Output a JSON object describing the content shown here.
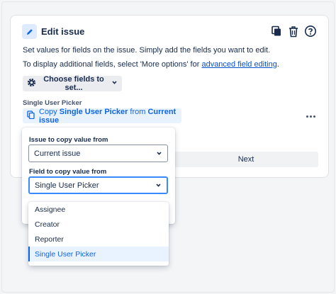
{
  "header": {
    "title": "Edit issue",
    "icons": [
      "pencil-icon",
      "copy-icon",
      "trash-icon",
      "help-icon"
    ]
  },
  "body": {
    "line1": "Set values for fields on the issue. Simply add the fields you want to edit.",
    "line2_prefix": "To display additional fields, select 'More options' for ",
    "line2_link": "advanced field editing",
    "line2_suffix": "."
  },
  "choose_button": {
    "label": "Choose fields to set...",
    "icon": "gear-icon"
  },
  "field": {
    "section_label": "Single User Picker",
    "chip_prefix": "Copy ",
    "chip_field": "Single User Picker",
    "chip_middle": " from ",
    "chip_source": "Current issue"
  },
  "next_button": {
    "label": "Next"
  },
  "popup": {
    "issue_label": "Issue to copy value from",
    "issue_value": "Current issue",
    "field_label": "Field to copy value from",
    "field_value": "Single User Picker"
  },
  "dropdown_options": [
    "Assignee",
    "Creator",
    "Reporter",
    "Single User Picker"
  ],
  "colors": {
    "accent": "#0c66e4",
    "focus": "#388bff",
    "chip_bg": "#e9f2ff"
  }
}
